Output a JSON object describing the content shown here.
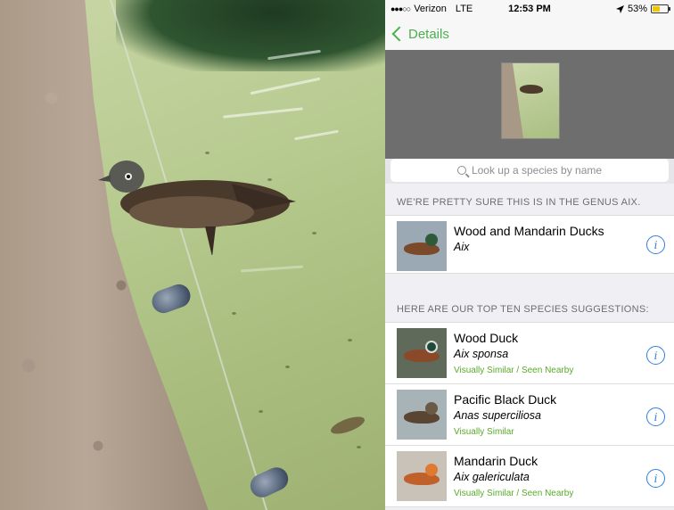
{
  "status_bar": {
    "carrier": "Verizon",
    "network": "LTE",
    "time": "12:53 PM",
    "battery": "53%",
    "battery_level": 0.53
  },
  "nav": {
    "back_label": "Details"
  },
  "search": {
    "placeholder": "Look up a species by name"
  },
  "genus_section": {
    "header": "WE'RE PRETTY SURE THIS IS IN THE GENUS AIX.",
    "item": {
      "name": "Wood and Mandarin Ducks",
      "scientific": "Aix"
    }
  },
  "species_section": {
    "header": "HERE ARE OUR TOP TEN SPECIES SUGGESTIONS:",
    "items": [
      {
        "name": "Wood Duck",
        "scientific": "Aix sponsa",
        "tag": "Visually Similar / Seen Nearby"
      },
      {
        "name": "Pacific Black Duck",
        "scientific": "Anas superciliosa",
        "tag": "Visually Similar"
      },
      {
        "name": "Mandarin Duck",
        "scientific": "Aix galericulata",
        "tag": "Visually Similar / Seen Nearby"
      }
    ]
  },
  "icons": {
    "back": "chevron-left-icon",
    "location": "location-arrow-icon",
    "search": "search-icon",
    "info": "info-icon"
  },
  "colors": {
    "accent_green": "#4caf50",
    "tag_green": "#5aaa2a",
    "info_blue": "#2f7fe0",
    "battery_yellow": "#f5c400"
  }
}
